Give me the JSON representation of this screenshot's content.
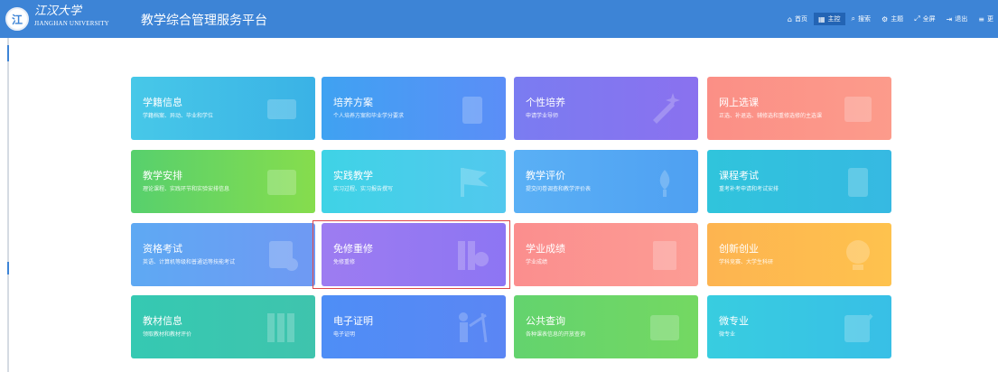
{
  "header": {
    "logo_mark": "江",
    "logo_name": "江汉大学",
    "logo_sub": "JIANGHAN UNIVERSITY",
    "title": "教学综合管理服务平台"
  },
  "nav": [
    {
      "label": "首页",
      "icon": "home-icon",
      "glyph": "⌂",
      "active": false
    },
    {
      "label": "主控",
      "icon": "dashboard-icon",
      "glyph": "▦",
      "active": true
    },
    {
      "label": "搜索",
      "icon": "search-icon",
      "glyph": "⌕",
      "active": false
    },
    {
      "label": "主题",
      "icon": "theme-icon",
      "glyph": "⚙",
      "active": false
    },
    {
      "label": "全屏",
      "icon": "fullscreen-icon",
      "glyph": "⤢",
      "active": false
    },
    {
      "label": "退出",
      "icon": "logout-icon",
      "glyph": "⇥",
      "active": false
    },
    {
      "label": "更",
      "icon": "menu-icon",
      "glyph": "≡",
      "active": false
    }
  ],
  "tiles": [
    {
      "title": "学籍信息",
      "desc": "学籍档案、异动、毕业和学位",
      "icon": "student-card-icon",
      "colors": [
        "#47c8e8",
        "#3ab2e6"
      ]
    },
    {
      "title": "培养方案",
      "desc": "个人培养方案和毕业学分要求",
      "icon": "clipboard-icon",
      "colors": [
        "#3fa2f2",
        "#5b8ef7"
      ]
    },
    {
      "title": "个性培养",
      "desc": "申请学业导师",
      "icon": "magic-wand-icon",
      "colors": [
        "#7a7cf1",
        "#8a71ef"
      ]
    },
    {
      "title": "网上选课",
      "desc": "正选、补退选、辅修选和重修选修的主选课",
      "icon": "calendar-heart-icon",
      "colors": [
        "#fb8f86",
        "#fc9b8b"
      ]
    },
    {
      "title": "教学安排",
      "desc": "理论课程、实践环节和实验安排信息",
      "icon": "calendar-grid-icon",
      "colors": [
        "#57d06d",
        "#86dd4d"
      ]
    },
    {
      "title": "实践教学",
      "desc": "实习过程、实习报告撰写",
      "icon": "flag-icon",
      "colors": [
        "#3fd3e6",
        "#52c8ee"
      ]
    },
    {
      "title": "教学评价",
      "desc": "提交问卷调查和教学评价表",
      "icon": "lotus-icon",
      "colors": [
        "#5ab0f5",
        "#4fa0f2"
      ]
    },
    {
      "title": "课程考试",
      "desc": "重考补考申请和考试安排",
      "icon": "scroll-icon",
      "colors": [
        "#30c4dc",
        "#36b9e2"
      ]
    },
    {
      "title": "资格考试",
      "desc": "英语、计算机等级和普通话等技能考试",
      "icon": "certificate-icon",
      "colors": [
        "#5ea9f3",
        "#6f99f3"
      ]
    },
    {
      "title": "免修重修",
      "desc": "免修重修",
      "icon": "books-icon",
      "colors": [
        "#9d7cf1",
        "#8d75f3"
      ]
    },
    {
      "title": "学业成绩",
      "desc": "学业成绩",
      "icon": "document-icon",
      "colors": [
        "#fb8e8e",
        "#fc9c94"
      ]
    },
    {
      "title": "创新创业",
      "desc": "学科竞赛、大学生科研",
      "icon": "lightbulb-icon",
      "colors": [
        "#fdb450",
        "#fec24e"
      ]
    },
    {
      "title": "教材信息",
      "desc": "领取教材和教材评价",
      "icon": "bookshelf-icon",
      "colors": [
        "#35c9b2",
        "#3fc4ad"
      ]
    },
    {
      "title": "电子证明",
      "desc": "电子证明",
      "icon": "teacher-board-icon",
      "colors": [
        "#4e8ef6",
        "#5b86f4"
      ]
    },
    {
      "title": "公共查询",
      "desc": "各种课表信息的开放查询",
      "icon": "calendar-grid-icon",
      "colors": [
        "#63d36e",
        "#74d862"
      ]
    },
    {
      "title": "微专业",
      "desc": "微专业",
      "icon": "edit-icon",
      "colors": [
        "#38cde0",
        "#38bfe6"
      ]
    }
  ]
}
